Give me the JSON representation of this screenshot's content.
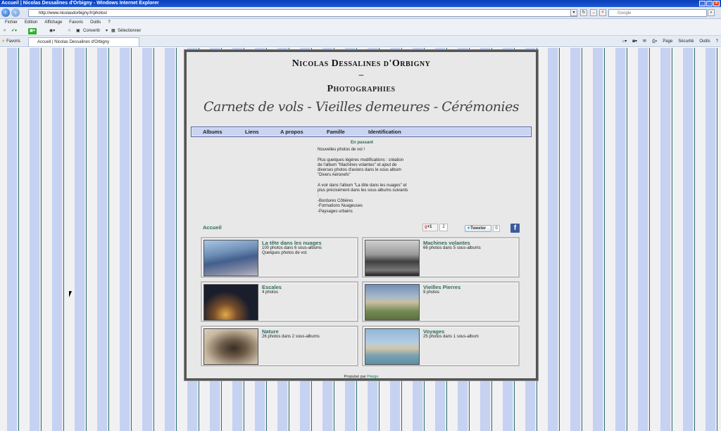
{
  "window": {
    "title": "Accueil | Nicolas Dessalines d'Orbigny - Windows Internet Explorer"
  },
  "address": {
    "url": "http://www.nicolasdorbigny.fr/photos/",
    "search_placeholder": "Google"
  },
  "menu": [
    "Fichier",
    "Edition",
    "Affichage",
    "Favoris",
    "Outils",
    "?"
  ],
  "toolbar": {
    "convert_label": "Convertir",
    "select_label": "Sélectionner"
  },
  "tabs": {
    "favorites_label": "Favoris",
    "active_tab": "Accueil | Nicolas Dessalines d'Orbigny"
  },
  "commandbar": [
    "Page",
    "Sécurité",
    "Outils"
  ],
  "site": {
    "title": "Nicolas Dessalines d'Orbigny",
    "dash": "–",
    "subtitle": "Photographies",
    "tagline": "Carnets de vols - Vieilles demeures - Cérémonies"
  },
  "nav": [
    "Albums",
    "Liens",
    "A propos",
    "Famille",
    "Identification"
  ],
  "news": {
    "title": "En passant",
    "paragraphs": [
      "Nouvelles photos de vol !",
      "Plus quelques légères modifications : création de l'album \"Machines volantes\" et ajout de diverses photos d'avions dans le sous album \"Divers Aéronefs\"",
      "A voir dans l'album \"La tête dans les nuages\" et plus précisément dans les sous albums suivants :\n-Bordures Côtières\n-Formations Nuageuses\n-Paysages urbains"
    ]
  },
  "breadcrumb": "Accueil",
  "social": {
    "gplus_label": "+1",
    "gplus_count": "2",
    "tweet_label": "Tweeter",
    "tweet_count": "0",
    "fb_label": "f"
  },
  "albums": [
    {
      "title": "La tête dans les nuages",
      "meta": "100 photos dans 6 sous-albums",
      "desc": "Quelques photos de vol."
    },
    {
      "title": "Machines volantes",
      "meta": "66 photos dans 5 sous-albums",
      "desc": ""
    },
    {
      "title": "Escales",
      "meta": "4 photos",
      "desc": ""
    },
    {
      "title": "Vieilles Pierres",
      "meta": "9 photos",
      "desc": ""
    },
    {
      "title": "Nature",
      "meta": "26 photos dans 2 sous-albums",
      "desc": ""
    },
    {
      "title": "Voyages",
      "meta": "25 photos dans 1 sous-album",
      "desc": ""
    }
  ],
  "footer": {
    "prefix": "Propulsé par",
    "link": "Piwigo"
  }
}
